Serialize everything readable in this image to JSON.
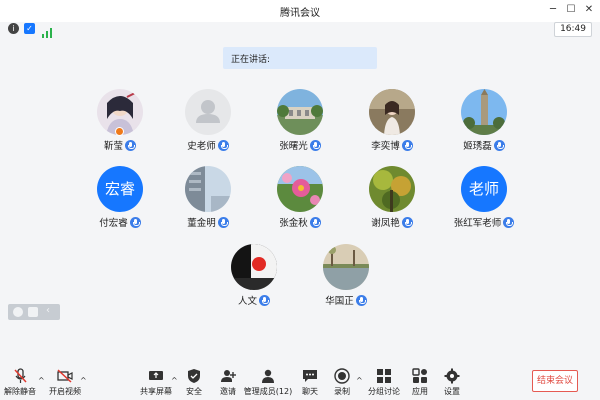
{
  "window": {
    "title": "腾讯会议"
  },
  "status": {
    "time": "16:49"
  },
  "speaking": {
    "label": "正在讲话:"
  },
  "participants": [
    {
      "name": "靳莹",
      "avatar": "photo-anime-girl",
      "host": true
    },
    {
      "name": "史老师",
      "avatar": "default-person"
    },
    {
      "name": "张曙光",
      "avatar": "photo-campus"
    },
    {
      "name": "李奕博",
      "avatar": "photo-girl-outdoor"
    },
    {
      "name": "姬琇磊",
      "avatar": "photo-tower-sky"
    },
    {
      "name": "付宏睿",
      "avatar_text": "宏睿",
      "avatar_color": "#1677ff"
    },
    {
      "name": "董金明",
      "avatar": "photo-sky-building"
    },
    {
      "name": "张金秋",
      "avatar": "photo-cosmos-flower"
    },
    {
      "name": "谢凤艳",
      "avatar": "photo-green-plant"
    },
    {
      "name": "张红军老师",
      "avatar_text": "老师",
      "avatar_color": "#1677ff"
    },
    {
      "name": "人文",
      "avatar": "photo-red-sun"
    },
    {
      "name": "华国正",
      "avatar": "photo-lake-tree"
    }
  ],
  "toolbar": {
    "mute": "解除静音",
    "video": "开启视频",
    "share": "共享屏幕",
    "security": "安全",
    "invite": "邀请",
    "members": "管理成员(12)",
    "chat": "聊天",
    "record": "录制",
    "breakout": "分组讨论",
    "apps": "应用",
    "settings": "设置",
    "end": "结束会议"
  },
  "colors": {
    "accent": "#1677ff",
    "end": "#e04a40",
    "speaking_bg": "#dbe9fb"
  }
}
